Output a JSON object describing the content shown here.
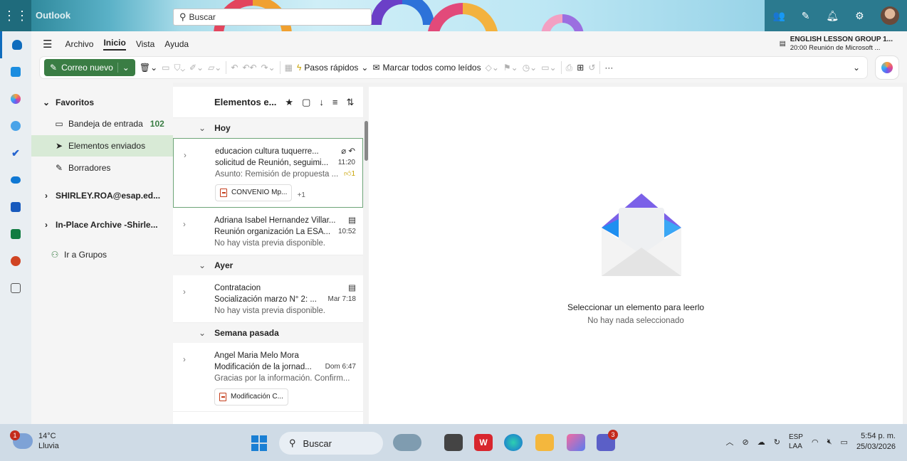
{
  "app": {
    "brand": "Outlook"
  },
  "search": {
    "placeholder": "Buscar"
  },
  "ribbon": {
    "tabs": [
      "Archivo",
      "Inicio",
      "Vista",
      "Ayuda"
    ],
    "new_mail": "Correo nuevo",
    "quick_steps": "Pasos rápidos",
    "mark_all_read": "Marcar todos como leídos",
    "more": "···"
  },
  "meeting": {
    "title": "ENGLISH LESSON GROUP 1...",
    "subtitle": "20:00 Reunión de Microsoft ..."
  },
  "folders": {
    "favorites": "Favoritos",
    "inbox": "Bandeja de entrada",
    "inbox_count": "102",
    "sent": "Elementos enviados",
    "drafts": "Borradores",
    "account": "SHIRLEY.ROA@esap.ed...",
    "archive": "In-Place Archive -Shirle...",
    "groups": "Ir a Grupos"
  },
  "list": {
    "title": "Elementos e...",
    "groups": [
      "Hoy",
      "Ayer",
      "Semana pasada"
    ],
    "messages": [
      {
        "from": "educacion cultura tuquerre...",
        "subject": "solicitud de Reunión, seguimi...",
        "time": "11:20",
        "preview": "Asunto: Remisión de propuesta ...",
        "reaction": "1",
        "attachment": "CONVENIO Mp...",
        "more_attach": "+1"
      },
      {
        "from": "Adriana Isabel Hernandez Villar...",
        "subject": "Reunión organización La ESA...",
        "time": "10:52",
        "preview": "No hay vista previa disponible."
      },
      {
        "from": "Contratacion",
        "subject": "Socialización marzo N° 2: ...",
        "time": "Mar 7:18",
        "preview": "No hay vista previa disponible."
      },
      {
        "from": "Angel Maria Melo Mora",
        "subject": "Modificación de la jornad...",
        "time": "Dom 6:47",
        "preview": "Gracias por la información. Confirm...",
        "attachment": "Modificación C..."
      }
    ]
  },
  "reading": {
    "title": "Seleccionar un elemento para leerlo",
    "subtitle": "No hay nada seleccionado"
  },
  "taskbar": {
    "temp": "14°C",
    "weather": "Lluvia",
    "weather_badge": "1",
    "search": "Buscar",
    "teams_badge": "3",
    "lang1": "ESP",
    "lang2": "LAA",
    "time": "5:54 p. m.",
    "date": "25/03/2026"
  },
  "colors": {
    "accent": "#0f6cbd",
    "new_mail_bg": "#3a7d44",
    "selected_folder": "#d8ead6"
  }
}
